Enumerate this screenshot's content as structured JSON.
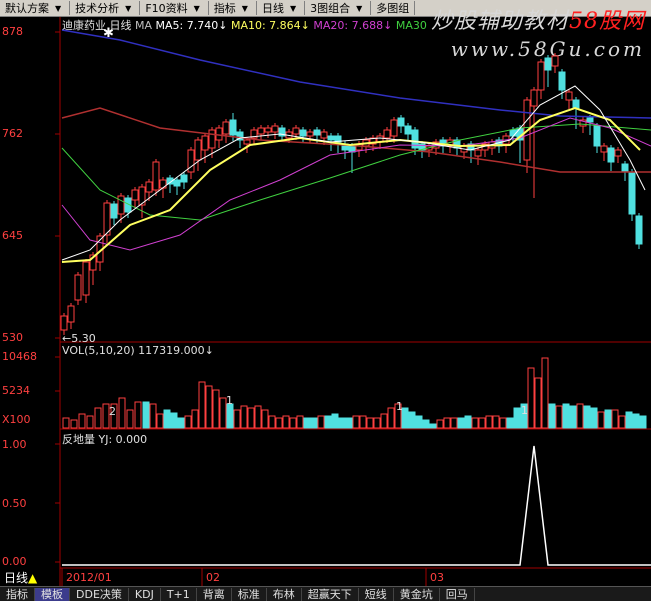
{
  "toolbar": {
    "items": [
      {
        "label": "默认方案",
        "arrow": true
      },
      {
        "label": "技术分析",
        "arrow": true
      },
      {
        "label": "F10资料",
        "arrow": true
      },
      {
        "label": "指标",
        "arrow": true
      },
      {
        "label": "日线",
        "arrow": true
      },
      {
        "label": "3图组合",
        "arrow": true
      },
      {
        "label": "多图组",
        "arrow": false
      }
    ]
  },
  "watermark": {
    "line1": "炒股辅助教材",
    "brand": "58股网",
    "line2": "www.58Gu.com"
  },
  "main": {
    "title": "迪康药业",
    "period": "日线",
    "ma_label": "MA",
    "ma5": "MA5: 7.740↓",
    "ma10": "MA10: 7.864↓",
    "ma20": "MA20: 7.688↓",
    "ma30": "MA30",
    "axis": [
      "878",
      "762",
      "645",
      "530"
    ],
    "low_marker": "←5.30",
    "high_marker": "✱"
  },
  "volume": {
    "header": "VOL(5,10,20) 117319.000↓",
    "axis": [
      "10468",
      "5234",
      "X100"
    ],
    "markers": [
      "2",
      "1",
      "1",
      "1",
      "3"
    ]
  },
  "indicator": {
    "name": "反地量",
    "value": "YJ: 0.000",
    "axis": [
      "1.00",
      "0.50",
      "0.00"
    ]
  },
  "bottom_axis": {
    "period_button": "日线",
    "dates": [
      "2012/01",
      "02",
      "03"
    ]
  },
  "bottom_tabs": [
    "指标",
    "模板",
    "DDE决策",
    "KDJ",
    "T+1",
    "背离",
    "标准",
    "布林",
    "超赢天下",
    "短线",
    "黄金坑",
    "回马"
  ],
  "colors": {
    "up": "#ff4040",
    "down": "#50e0e0",
    "ma5": "#ffffff",
    "ma10": "#ffff60",
    "ma20": "#d040d0",
    "ma30": "#40d040",
    "ma60": "#b03030",
    "ma120": "#3030c0",
    "axis": "#a00000"
  }
}
